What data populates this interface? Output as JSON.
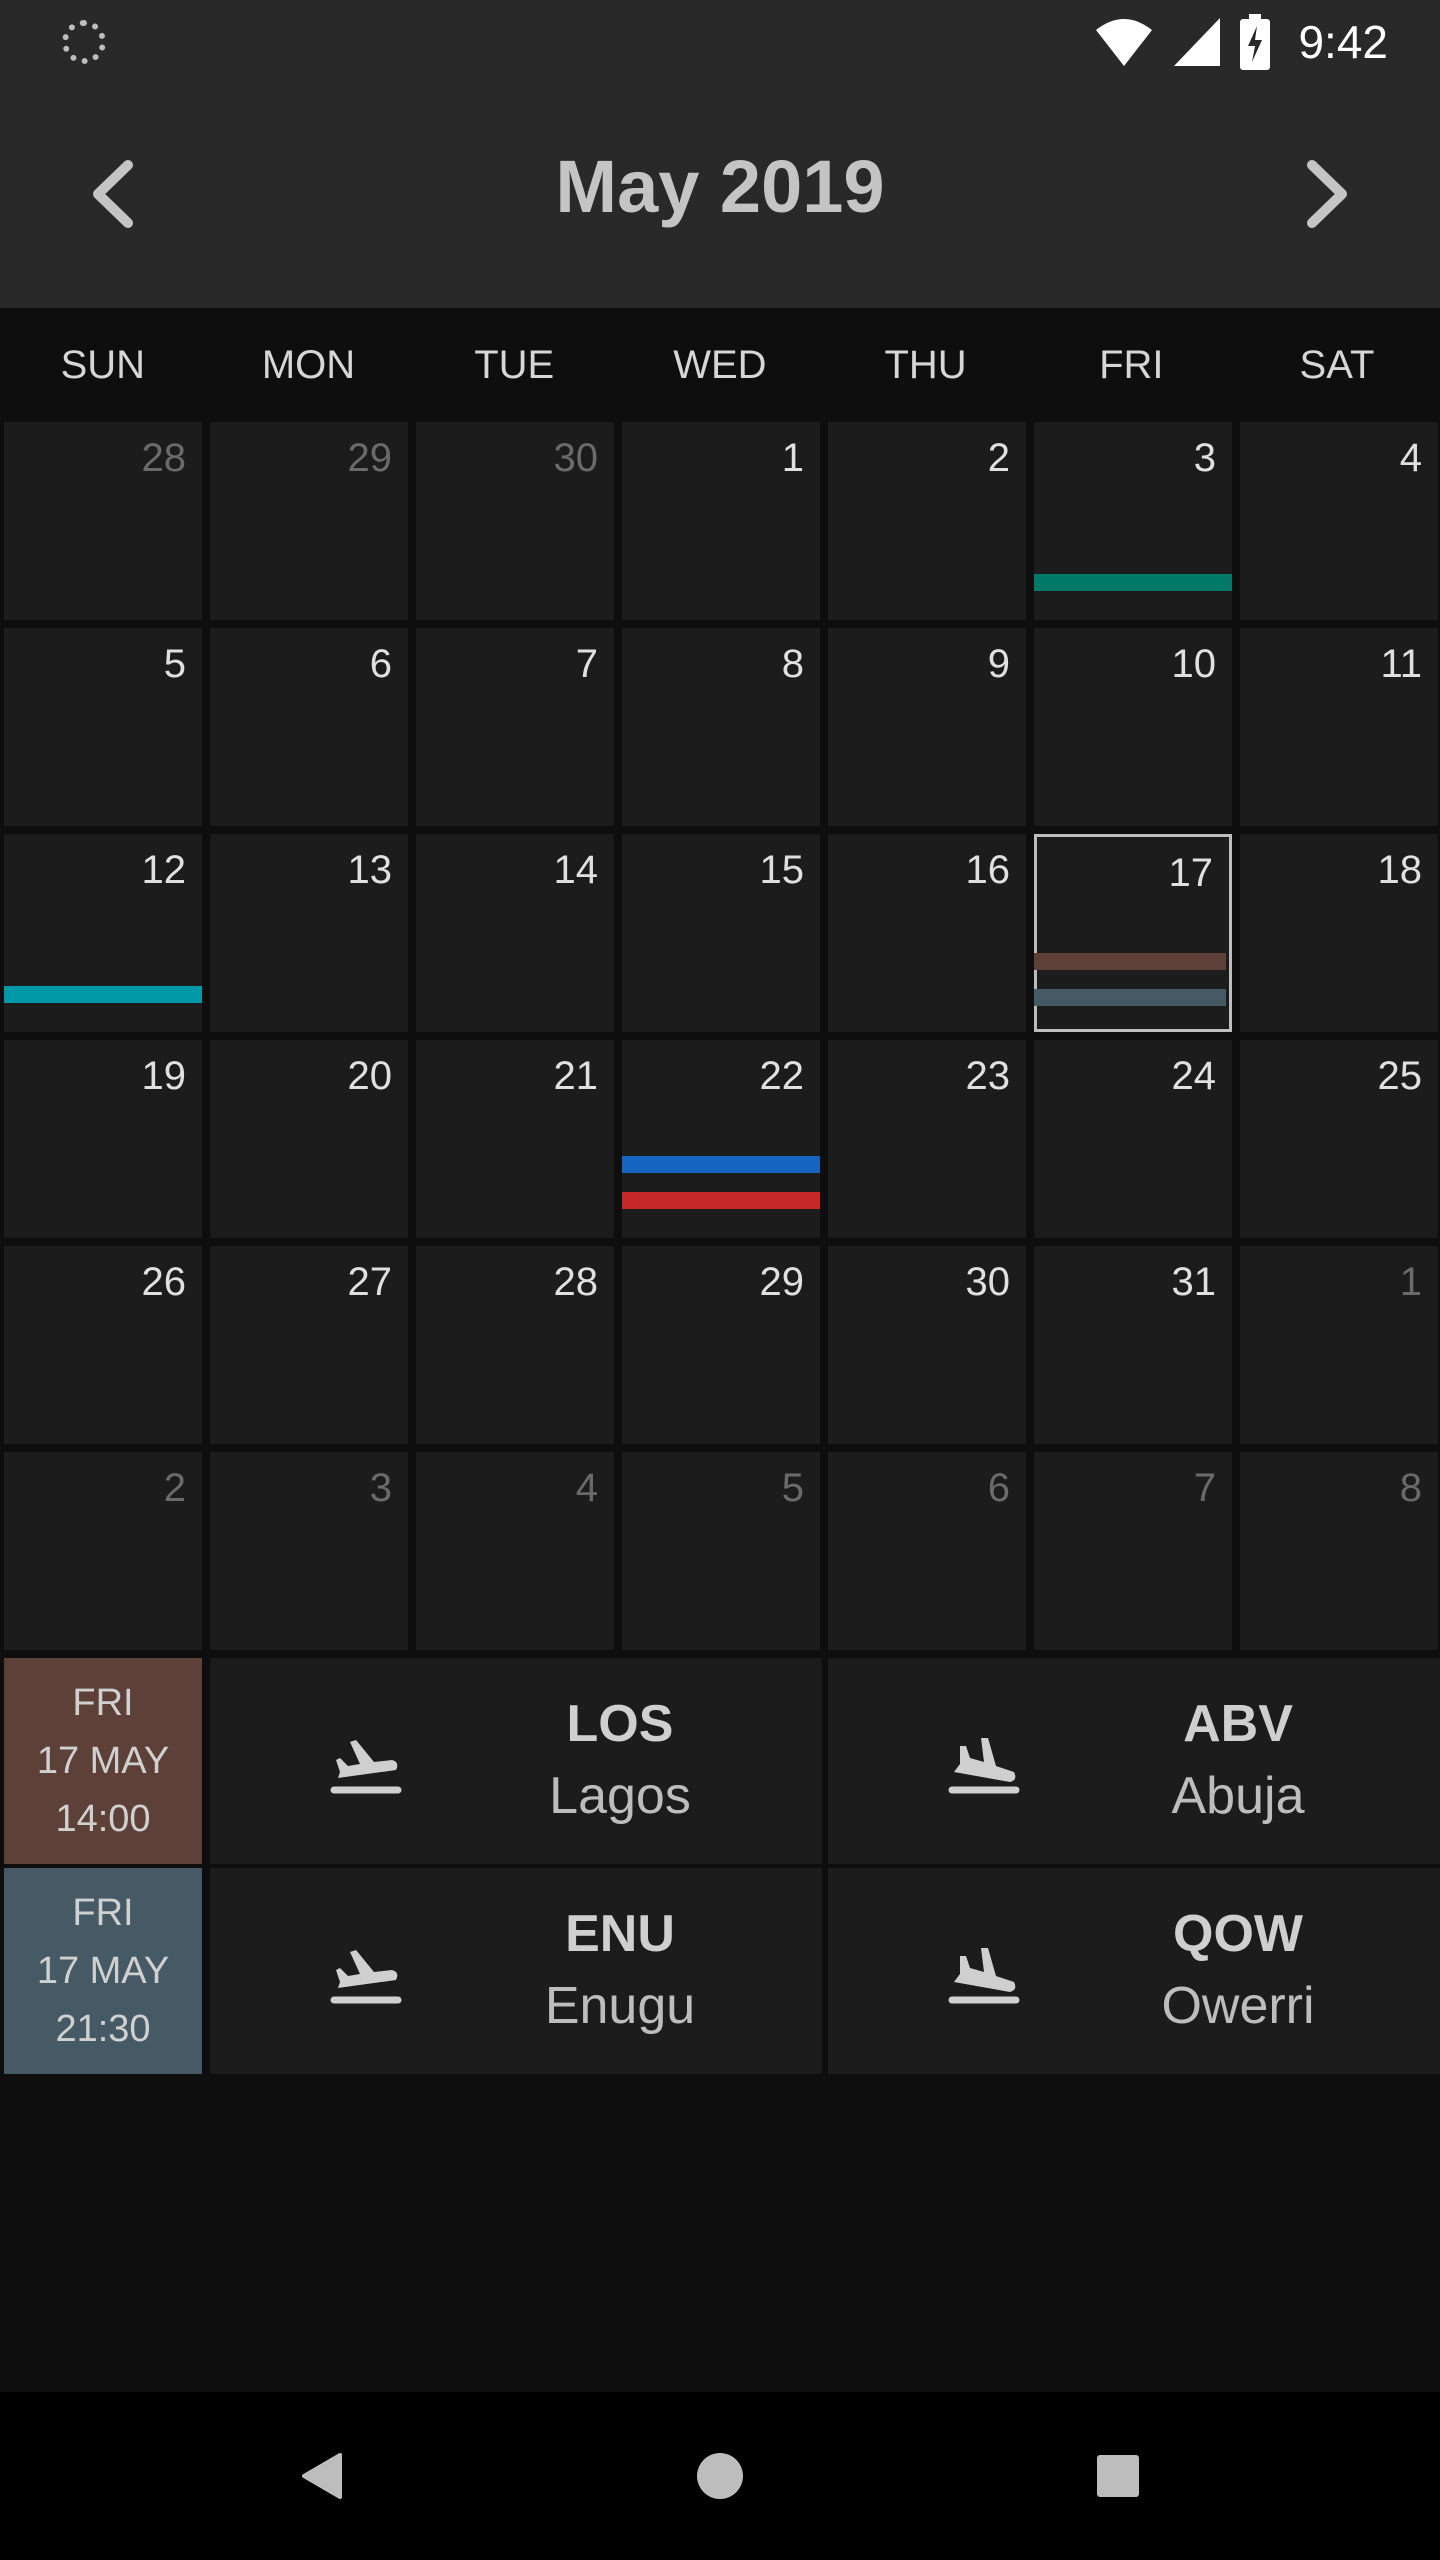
{
  "status_bar": {
    "time": "9:42",
    "icons": [
      "sync-icon",
      "wifi-icon",
      "signal-icon",
      "battery-charging-icon"
    ]
  },
  "header": {
    "title": "May 2019",
    "prev_icon": "chevron-left-icon",
    "next_icon": "chevron-right-icon"
  },
  "weekdays": [
    "SUN",
    "MON",
    "TUE",
    "WED",
    "THU",
    "FRI",
    "SAT"
  ],
  "days": [
    {
      "label": "28",
      "current": false,
      "events": []
    },
    {
      "label": "29",
      "current": false,
      "events": []
    },
    {
      "label": "30",
      "current": false,
      "events": []
    },
    {
      "label": "1",
      "current": true,
      "events": []
    },
    {
      "label": "2",
      "current": true,
      "events": []
    },
    {
      "label": "3",
      "current": true,
      "events": [
        "#00796b"
      ]
    },
    {
      "label": "4",
      "current": true,
      "events": []
    },
    {
      "label": "5",
      "current": true,
      "events": []
    },
    {
      "label": "6",
      "current": true,
      "events": []
    },
    {
      "label": "7",
      "current": true,
      "events": []
    },
    {
      "label": "8",
      "current": true,
      "events": []
    },
    {
      "label": "9",
      "current": true,
      "events": []
    },
    {
      "label": "10",
      "current": true,
      "events": []
    },
    {
      "label": "11",
      "current": true,
      "events": []
    },
    {
      "label": "12",
      "current": true,
      "events": [
        "#0097a7"
      ]
    },
    {
      "label": "13",
      "current": true,
      "events": []
    },
    {
      "label": "14",
      "current": true,
      "events": []
    },
    {
      "label": "15",
      "current": true,
      "events": []
    },
    {
      "label": "16",
      "current": true,
      "events": []
    },
    {
      "label": "17",
      "current": true,
      "selected": true,
      "events": [
        "#5d4037",
        "#455a64"
      ]
    },
    {
      "label": "18",
      "current": true,
      "events": []
    },
    {
      "label": "19",
      "current": true,
      "events": []
    },
    {
      "label": "20",
      "current": true,
      "events": []
    },
    {
      "label": "21",
      "current": true,
      "events": []
    },
    {
      "label": "22",
      "current": true,
      "events": [
        "#1565c0",
        "#c62828"
      ]
    },
    {
      "label": "23",
      "current": true,
      "events": []
    },
    {
      "label": "24",
      "current": true,
      "events": []
    },
    {
      "label": "25",
      "current": true,
      "events": []
    },
    {
      "label": "26",
      "current": true,
      "events": []
    },
    {
      "label": "27",
      "current": true,
      "events": []
    },
    {
      "label": "28",
      "current": true,
      "events": []
    },
    {
      "label": "29",
      "current": true,
      "events": []
    },
    {
      "label": "30",
      "current": true,
      "events": []
    },
    {
      "label": "31",
      "current": true,
      "events": []
    },
    {
      "label": "1",
      "current": false,
      "events": []
    },
    {
      "label": "2",
      "current": false,
      "events": []
    },
    {
      "label": "3",
      "current": false,
      "events": []
    },
    {
      "label": "4",
      "current": false,
      "events": []
    },
    {
      "label": "5",
      "current": false,
      "events": []
    },
    {
      "label": "6",
      "current": false,
      "events": []
    },
    {
      "label": "7",
      "current": false,
      "events": []
    },
    {
      "label": "8",
      "current": false,
      "events": []
    }
  ],
  "flights": [
    {
      "day": "FRI",
      "date": "17 MAY",
      "time": "14:00",
      "color": "#5d4037",
      "departure": {
        "code": "LOS",
        "city": "Lagos"
      },
      "arrival": {
        "code": "ABV",
        "city": "Abuja"
      }
    },
    {
      "day": "FRI",
      "date": "17 MAY",
      "time": "21:30",
      "color": "#455a64",
      "departure": {
        "code": "ENU",
        "city": "Enugu"
      },
      "arrival": {
        "code": "QOW",
        "city": "Owerri"
      }
    }
  ],
  "nav_bar": {
    "icons": [
      "back-icon",
      "home-icon",
      "recents-icon"
    ]
  },
  "colors": {
    "background": "#0e0e0e",
    "header": "#292929",
    "cell": "#1c1c1c",
    "text": "#e0e0e0",
    "muted_text": "#6a6a6a"
  }
}
